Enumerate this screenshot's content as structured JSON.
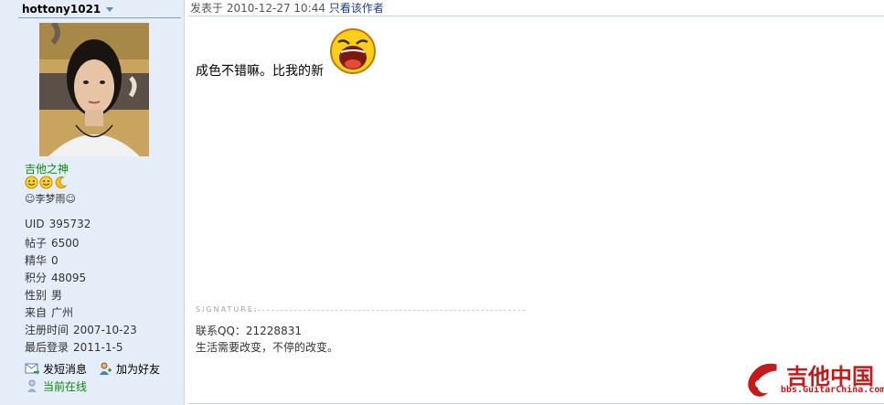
{
  "author": {
    "username": "hottony1021",
    "rank_title": "吉他之神",
    "custom_title": "☺李梦雨☺",
    "stats": [
      {
        "label": "UID",
        "value": "395732"
      },
      {
        "label": "帖子",
        "value": "6500"
      },
      {
        "label": "精华",
        "value": "0"
      },
      {
        "label": "积分",
        "value": "48095"
      },
      {
        "label": "性别",
        "value": "男"
      },
      {
        "label": "来自",
        "value": "广州"
      },
      {
        "label": "注册时间",
        "value": "2007-10-23"
      },
      {
        "label": "最后登录",
        "value": "2011-1-5"
      }
    ],
    "actions": {
      "message": "发短消息",
      "add_friend": "加为好友",
      "online": "当前在线"
    }
  },
  "post": {
    "posted_label": "发表于",
    "posted_time": "2010-12-27 10:44",
    "only_author_link": "只看该作者",
    "body": "成色不错嘛。比我的新",
    "signature": {
      "label": "SIGNATURE:",
      "line1": "联系QQ：21228831",
      "line2": "生活需要改变，不停的改变。"
    }
  },
  "watermark": {
    "main": "吉他中国",
    "sub": "bbs.GuitarChina.com"
  },
  "colors": {
    "sidebar_bg": "#e5eef8",
    "rank_green": "#0a8a0a",
    "link_blue": "#1f3a93",
    "brand_red": "#c41a1a"
  },
  "icons": {
    "username_menu": "chevron-down-icon",
    "rank": "smiley-icon",
    "message": "envelope-icon",
    "add_friend": "user-add-icon",
    "online": "user-online-icon",
    "post_emoji": "laughing-face-icon"
  }
}
